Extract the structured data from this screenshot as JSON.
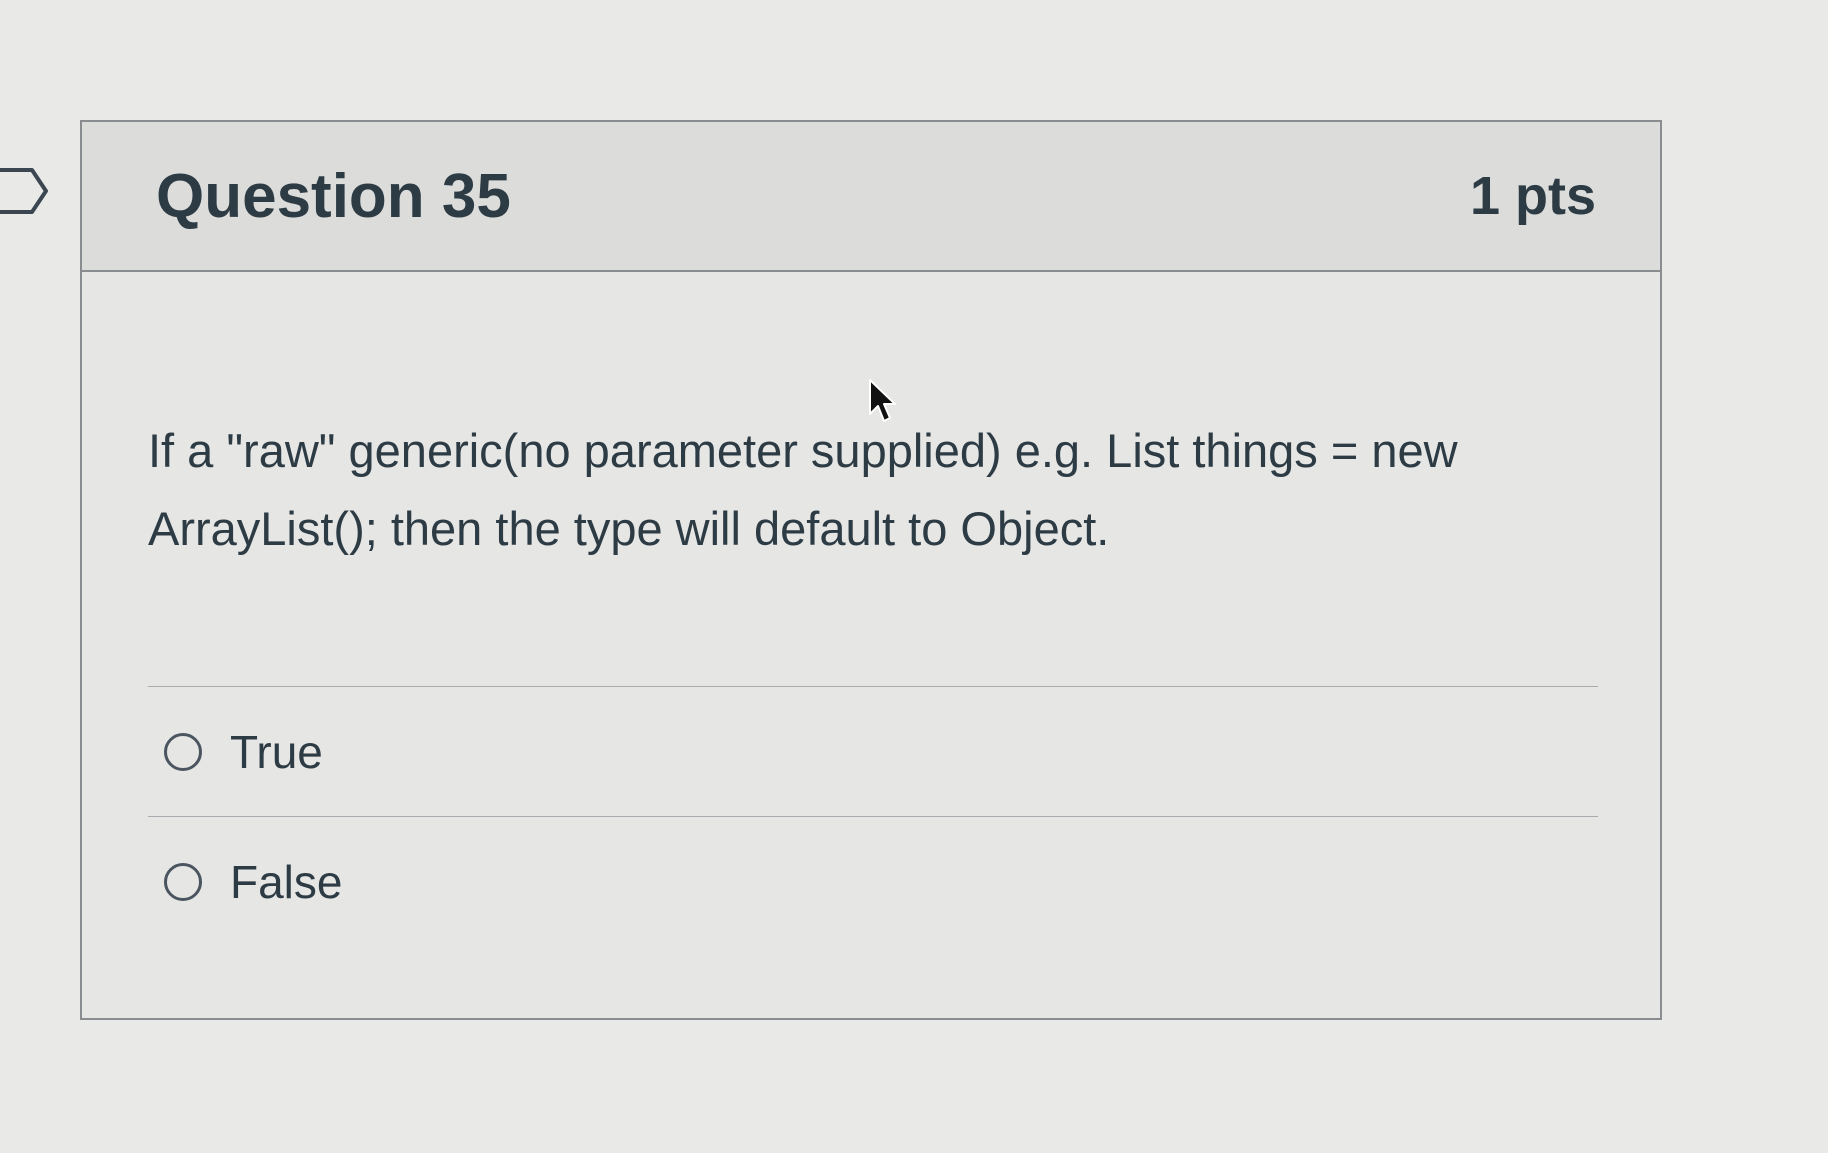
{
  "question": {
    "title": "Question 35",
    "points": "1 pts",
    "text": "If a \"raw\" generic(no parameter supplied) e.g. List things = new ArrayList(); then the type will default to Object."
  },
  "answers": [
    {
      "label": "True",
      "selected": false
    },
    {
      "label": "False",
      "selected": false
    }
  ],
  "icons": {
    "bookmark": "bookmark-flag-icon",
    "cursor": "mouse-pointer-icon"
  },
  "colors": {
    "text": "#2d3b45",
    "border": "#8a8d90",
    "header_bg": "#dcdcda",
    "page_bg": "#e9e9e7"
  }
}
